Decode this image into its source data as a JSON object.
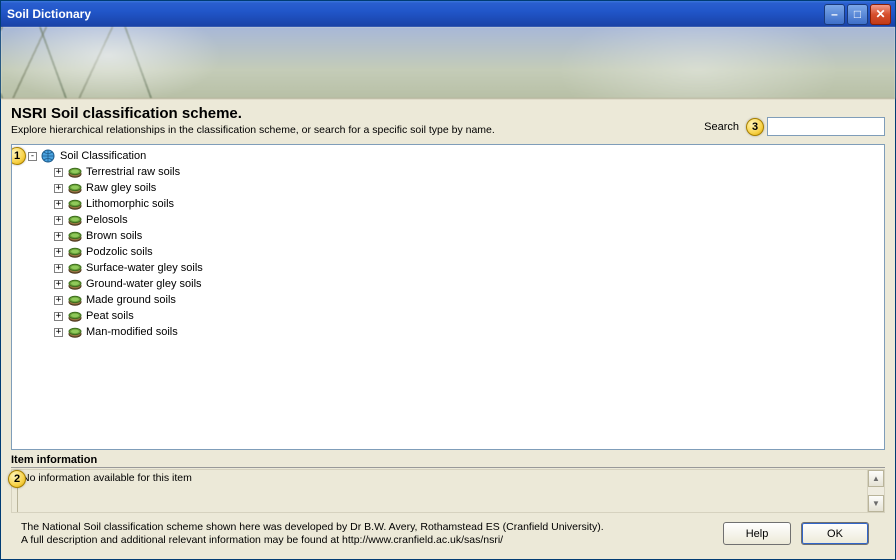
{
  "window": {
    "title": "Soil Dictionary"
  },
  "header": {
    "title": "NSRI Soil classification scheme.",
    "subtitle": "Explore hierarchical relationships in the classification scheme, or search for a specific soil type by name."
  },
  "search": {
    "label": "Search",
    "value": "",
    "placeholder": ""
  },
  "tree": {
    "root": {
      "label": "Soil Classification",
      "expanded": true
    },
    "children": [
      {
        "label": "Terrestrial raw soils"
      },
      {
        "label": "Raw gley soils"
      },
      {
        "label": "Lithomorphic soils"
      },
      {
        "label": "Pelosols"
      },
      {
        "label": "Brown soils"
      },
      {
        "label": "Podzolic soils"
      },
      {
        "label": "Surface-water gley soils"
      },
      {
        "label": "Ground-water gley soils"
      },
      {
        "label": "Made ground soils"
      },
      {
        "label": "Peat soils"
      },
      {
        "label": "Man-modified soils"
      }
    ]
  },
  "info": {
    "heading": "Item information",
    "text": "No information available for this item"
  },
  "footer": {
    "line1": "The National Soil classification scheme shown here was developed by Dr B.W. Avery, Rothamstead ES (Cranfield University).",
    "line2": "A full description and additional relevant information may be found at http://www.cranfield.ac.uk/sas/nsri/"
  },
  "buttons": {
    "help": "Help",
    "ok": "OK"
  },
  "callouts": {
    "c1": "1",
    "c2": "2",
    "c3": "3"
  }
}
